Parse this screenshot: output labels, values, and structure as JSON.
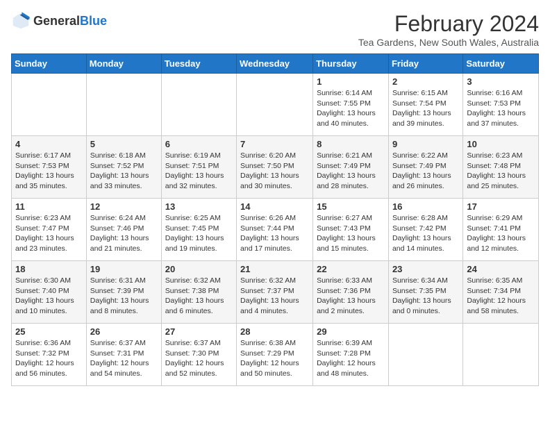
{
  "header": {
    "logo_general": "General",
    "logo_blue": "Blue",
    "month_year": "February 2024",
    "location": "Tea Gardens, New South Wales, Australia"
  },
  "days_of_week": [
    "Sunday",
    "Monday",
    "Tuesday",
    "Wednesday",
    "Thursday",
    "Friday",
    "Saturday"
  ],
  "weeks": [
    [
      {
        "day": "",
        "info": ""
      },
      {
        "day": "",
        "info": ""
      },
      {
        "day": "",
        "info": ""
      },
      {
        "day": "",
        "info": ""
      },
      {
        "day": "1",
        "info": "Sunrise: 6:14 AM\nSunset: 7:55 PM\nDaylight: 13 hours\nand 40 minutes."
      },
      {
        "day": "2",
        "info": "Sunrise: 6:15 AM\nSunset: 7:54 PM\nDaylight: 13 hours\nand 39 minutes."
      },
      {
        "day": "3",
        "info": "Sunrise: 6:16 AM\nSunset: 7:53 PM\nDaylight: 13 hours\nand 37 minutes."
      }
    ],
    [
      {
        "day": "4",
        "info": "Sunrise: 6:17 AM\nSunset: 7:53 PM\nDaylight: 13 hours\nand 35 minutes."
      },
      {
        "day": "5",
        "info": "Sunrise: 6:18 AM\nSunset: 7:52 PM\nDaylight: 13 hours\nand 33 minutes."
      },
      {
        "day": "6",
        "info": "Sunrise: 6:19 AM\nSunset: 7:51 PM\nDaylight: 13 hours\nand 32 minutes."
      },
      {
        "day": "7",
        "info": "Sunrise: 6:20 AM\nSunset: 7:50 PM\nDaylight: 13 hours\nand 30 minutes."
      },
      {
        "day": "8",
        "info": "Sunrise: 6:21 AM\nSunset: 7:49 PM\nDaylight: 13 hours\nand 28 minutes."
      },
      {
        "day": "9",
        "info": "Sunrise: 6:22 AM\nSunset: 7:49 PM\nDaylight: 13 hours\nand 26 minutes."
      },
      {
        "day": "10",
        "info": "Sunrise: 6:23 AM\nSunset: 7:48 PM\nDaylight: 13 hours\nand 25 minutes."
      }
    ],
    [
      {
        "day": "11",
        "info": "Sunrise: 6:23 AM\nSunset: 7:47 PM\nDaylight: 13 hours\nand 23 minutes."
      },
      {
        "day": "12",
        "info": "Sunrise: 6:24 AM\nSunset: 7:46 PM\nDaylight: 13 hours\nand 21 minutes."
      },
      {
        "day": "13",
        "info": "Sunrise: 6:25 AM\nSunset: 7:45 PM\nDaylight: 13 hours\nand 19 minutes."
      },
      {
        "day": "14",
        "info": "Sunrise: 6:26 AM\nSunset: 7:44 PM\nDaylight: 13 hours\nand 17 minutes."
      },
      {
        "day": "15",
        "info": "Sunrise: 6:27 AM\nSunset: 7:43 PM\nDaylight: 13 hours\nand 15 minutes."
      },
      {
        "day": "16",
        "info": "Sunrise: 6:28 AM\nSunset: 7:42 PM\nDaylight: 13 hours\nand 14 minutes."
      },
      {
        "day": "17",
        "info": "Sunrise: 6:29 AM\nSunset: 7:41 PM\nDaylight: 13 hours\nand 12 minutes."
      }
    ],
    [
      {
        "day": "18",
        "info": "Sunrise: 6:30 AM\nSunset: 7:40 PM\nDaylight: 13 hours\nand 10 minutes."
      },
      {
        "day": "19",
        "info": "Sunrise: 6:31 AM\nSunset: 7:39 PM\nDaylight: 13 hours\nand 8 minutes."
      },
      {
        "day": "20",
        "info": "Sunrise: 6:32 AM\nSunset: 7:38 PM\nDaylight: 13 hours\nand 6 minutes."
      },
      {
        "day": "21",
        "info": "Sunrise: 6:32 AM\nSunset: 7:37 PM\nDaylight: 13 hours\nand 4 minutes."
      },
      {
        "day": "22",
        "info": "Sunrise: 6:33 AM\nSunset: 7:36 PM\nDaylight: 13 hours\nand 2 minutes."
      },
      {
        "day": "23",
        "info": "Sunrise: 6:34 AM\nSunset: 7:35 PM\nDaylight: 13 hours\nand 0 minutes."
      },
      {
        "day": "24",
        "info": "Sunrise: 6:35 AM\nSunset: 7:34 PM\nDaylight: 12 hours\nand 58 minutes."
      }
    ],
    [
      {
        "day": "25",
        "info": "Sunrise: 6:36 AM\nSunset: 7:32 PM\nDaylight: 12 hours\nand 56 minutes."
      },
      {
        "day": "26",
        "info": "Sunrise: 6:37 AM\nSunset: 7:31 PM\nDaylight: 12 hours\nand 54 minutes."
      },
      {
        "day": "27",
        "info": "Sunrise: 6:37 AM\nSunset: 7:30 PM\nDaylight: 12 hours\nand 52 minutes."
      },
      {
        "day": "28",
        "info": "Sunrise: 6:38 AM\nSunset: 7:29 PM\nDaylight: 12 hours\nand 50 minutes."
      },
      {
        "day": "29",
        "info": "Sunrise: 6:39 AM\nSunset: 7:28 PM\nDaylight: 12 hours\nand 48 minutes."
      },
      {
        "day": "",
        "info": ""
      },
      {
        "day": "",
        "info": ""
      }
    ]
  ]
}
